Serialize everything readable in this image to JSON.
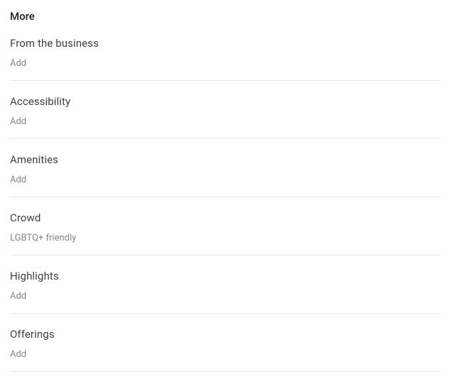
{
  "page_title": "More",
  "sections": [
    {
      "title": "From the business",
      "value": "Add",
      "interactable": true
    },
    {
      "title": "Accessibility",
      "value": "Add",
      "interactable": true
    },
    {
      "title": "Amenities",
      "value": "Add",
      "interactable": true
    },
    {
      "title": "Crowd",
      "value": "LGBTQ+ friendly",
      "interactable": true
    },
    {
      "title": "Highlights",
      "value": "Add",
      "interactable": true
    },
    {
      "title": "Offerings",
      "value": "Add",
      "interactable": true
    }
  ]
}
